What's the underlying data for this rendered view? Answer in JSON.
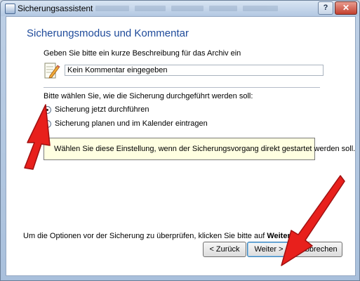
{
  "window": {
    "title": "Sicherungsassistent",
    "help_label": "?",
    "close_label": "✕"
  },
  "page": {
    "heading": "Sicherungsmodus und Kommentar",
    "description_label": "Geben Sie bitte ein kurze Beschreibung für das Archiv ein",
    "comment_value": "Kein Kommentar eingegeben",
    "mode_label": "Bitte wählen Sie, wie die Sicherung durchgeführt werden soll:",
    "options": [
      {
        "label": "Sicherung jetzt durchführen",
        "selected": true
      },
      {
        "label": "Sicherung planen und im Kalender eintragen",
        "selected": false
      }
    ],
    "info_text": "Wählen Sie diese Einstellung, wenn der Sicherungsvorgang direkt gestartet werden soll.",
    "footer_text": "Um die Optionen vor der Sicherung zu überprüfen, klicken Sie bitte auf",
    "footer_bold": "Weiter"
  },
  "buttons": {
    "back": "< Zurück",
    "next": "Weiter >",
    "cancel": "Abbrechen"
  },
  "icons": {
    "app": "backup-app-icon",
    "comment": "note-pencil-icon",
    "annotation": "red-arrow-icon"
  },
  "colors": {
    "heading": "#1e4a9a",
    "info_background": "#ffffe1",
    "annotation_arrow": "#e8201c"
  }
}
